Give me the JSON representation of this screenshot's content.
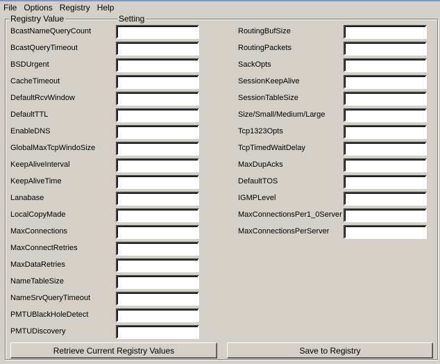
{
  "menu": [
    "File",
    "Options",
    "Registry",
    "Help"
  ],
  "group": {
    "col1_label": "Registry Value",
    "col2_label": "Setting"
  },
  "left_fields": [
    {
      "label": "BcastNameQueryCount",
      "value": ""
    },
    {
      "label": "BcastQueryTimeout",
      "value": ""
    },
    {
      "label": "BSDUrgent",
      "value": ""
    },
    {
      "label": "CacheTimeout",
      "value": ""
    },
    {
      "label": "DefaultRcvWindow",
      "value": ""
    },
    {
      "label": "DefaultTTL",
      "value": ""
    },
    {
      "label": "EnableDNS",
      "value": ""
    },
    {
      "label": "GlobalMaxTcpWindoSize",
      "value": ""
    },
    {
      "label": "KeepAliveInterval",
      "value": ""
    },
    {
      "label": "KeepAliveTime",
      "value": ""
    },
    {
      "label": "Lanabase",
      "value": ""
    },
    {
      "label": "LocalCopyMade",
      "value": ""
    },
    {
      "label": "MaxConnections",
      "value": ""
    },
    {
      "label": "MaxConnectRetries",
      "value": ""
    },
    {
      "label": "MaxDataRetries",
      "value": ""
    },
    {
      "label": "NameTableSize",
      "value": ""
    },
    {
      "label": "NameSrvQueryTimeout",
      "value": ""
    },
    {
      "label": "PMTUBlackHoleDetect",
      "value": ""
    },
    {
      "label": "PMTUDiscovery",
      "value": ""
    }
  ],
  "right_fields": [
    {
      "label": "RoutingBufSize",
      "value": ""
    },
    {
      "label": "RoutingPackets",
      "value": ""
    },
    {
      "label": "SackOpts",
      "value": ""
    },
    {
      "label": "SessionKeepAlive",
      "value": ""
    },
    {
      "label": "SessionTableSize",
      "value": ""
    },
    {
      "label": "Size/Small/Medium/Large",
      "value": ""
    },
    {
      "label": "Tcp1323Opts",
      "value": ""
    },
    {
      "label": "TcpTimedWaitDelay",
      "value": ""
    },
    {
      "label": "MaxDupAcks",
      "value": ""
    },
    {
      "label": "DefaultTOS",
      "value": ""
    },
    {
      "label": "IGMPLevel",
      "value": ""
    },
    {
      "label": "MaxConnectionsPer1_0Server",
      "value": ""
    },
    {
      "label": "MaxConnectionsPerServer",
      "value": ""
    }
  ],
  "buttons": {
    "retrieve": "Retrieve Current Registry Values",
    "save": "Save to Registry"
  }
}
